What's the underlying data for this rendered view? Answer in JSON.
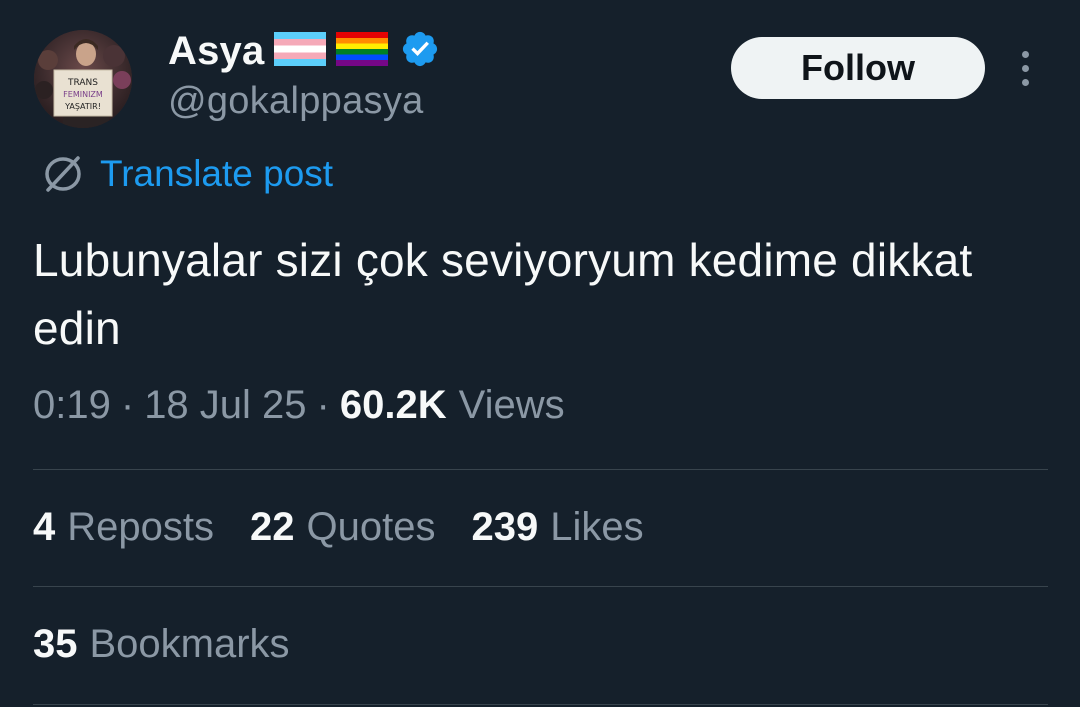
{
  "author": {
    "display_name": "Asya",
    "handle": "@gokalppasya",
    "avatar_sign_text": [
      "TRANS",
      "FEMINIZM",
      "YAŞATIR!"
    ]
  },
  "header": {
    "follow_label": "Follow"
  },
  "translate": {
    "label": "Translate post"
  },
  "post": {
    "text": "Lubunyalar sizi çok seviyoryum kedime dikkat edin"
  },
  "meta": {
    "time": "0:19",
    "separator": "·",
    "date": "18 Jul 25",
    "views_count": "60.2K",
    "views_label": "Views"
  },
  "stats": {
    "reposts_count": "4",
    "reposts_label": "Reposts",
    "quotes_count": "22",
    "quotes_label": "Quotes",
    "likes_count": "239",
    "likes_label": "Likes",
    "bookmarks_count": "35",
    "bookmarks_label": "Bookmarks"
  },
  "colors": {
    "background": "#15202b",
    "text_primary": "#f7f9f9",
    "text_secondary": "#8b98a5",
    "accent": "#1d9bf0",
    "divider": "#38444d",
    "follow_bg": "#eff3f4"
  }
}
